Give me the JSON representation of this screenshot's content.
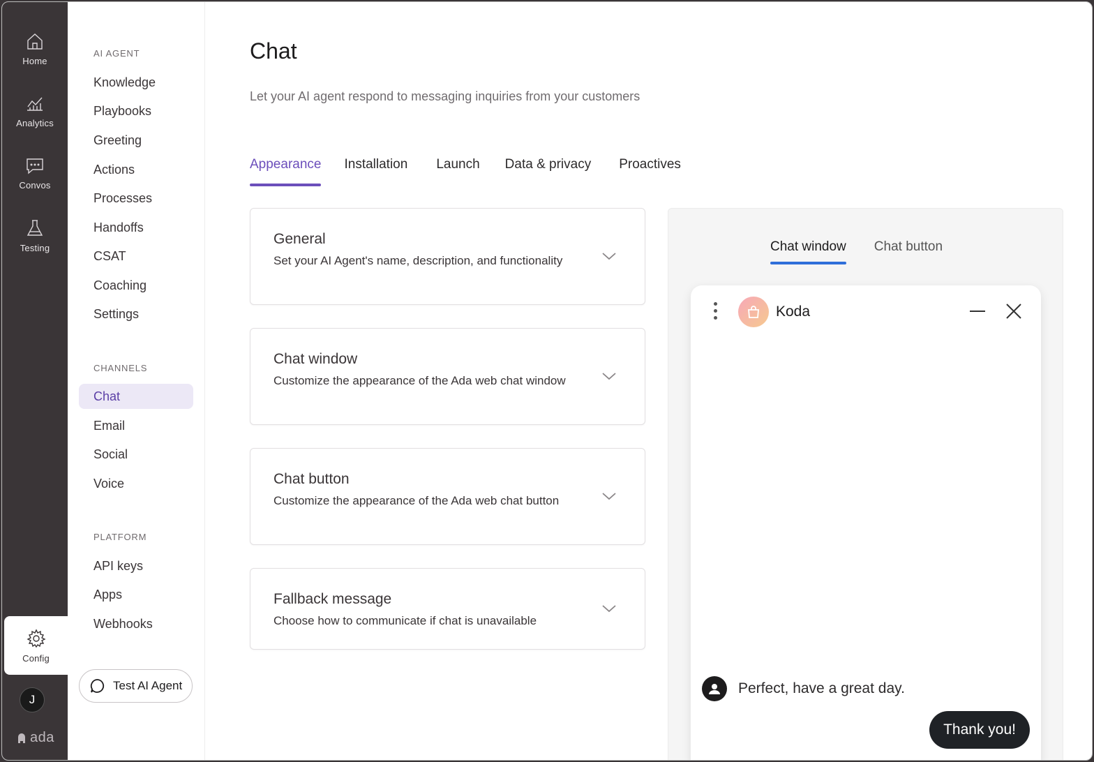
{
  "rail": {
    "items": [
      {
        "label": "Home",
        "icon": "home-icon"
      },
      {
        "label": "Analytics",
        "icon": "analytics-icon"
      },
      {
        "label": "Convos",
        "icon": "convos-icon"
      },
      {
        "label": "Testing",
        "icon": "testing-icon"
      },
      {
        "label": "Config",
        "icon": "config-icon",
        "active": true
      }
    ],
    "avatar_initial": "J",
    "brand": "ada"
  },
  "nav": {
    "ai_agent_heading": "AI AGENT",
    "ai_agent_items": [
      "Knowledge",
      "Playbooks",
      "Greeting",
      "Actions",
      "Processes",
      "Handoffs",
      "CSAT",
      "Coaching",
      "Settings"
    ],
    "channels_heading": "CHANNELS",
    "channels_items": [
      "Chat",
      "Email",
      "Social",
      "Voice"
    ],
    "active_item": "Chat",
    "platform_heading": "PLATFORM",
    "platform_items": [
      "API keys",
      "Apps",
      "Webhooks"
    ],
    "test_button": "Test AI Agent"
  },
  "main": {
    "title": "Chat",
    "subtitle": "Let your AI agent respond to messaging inquiries from your customers",
    "tabs": [
      "Appearance",
      "Installation",
      "Launch",
      "Data & privacy",
      "Proactives"
    ],
    "active_tab": "Appearance",
    "cards": [
      {
        "title": "General",
        "desc": "Set your AI Agent's name, description, and functionality"
      },
      {
        "title": "Chat window",
        "desc": "Customize the appearance of the Ada web chat window"
      },
      {
        "title": "Chat button",
        "desc": "Customize the appearance of the Ada web chat button"
      },
      {
        "title": "Fallback message",
        "desc": "Choose how to communicate if chat is unavailable"
      }
    ]
  },
  "preview": {
    "tabs": [
      "Chat window",
      "Chat button"
    ],
    "active_tab": "Chat window",
    "bot_name": "Koda",
    "bot_message": "Perfect, have a great day.",
    "user_message": "Thank you!"
  },
  "colors": {
    "rail_bg": "#3a3537",
    "accent_purple": "#6c4fbb",
    "preview_tab_accent": "#2f6fd9",
    "nav_active_bg": "#ece8f6"
  }
}
